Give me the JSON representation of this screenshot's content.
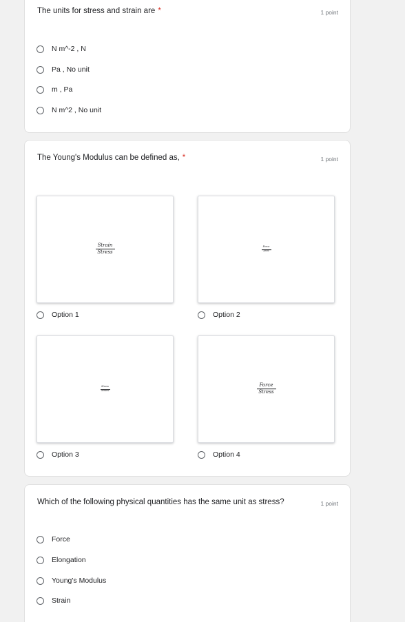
{
  "questions": [
    {
      "title": "The units for stress and strain are",
      "required_mark": "*",
      "points": "1 point",
      "options": [
        "N m^-2 , N",
        "Pa , No unit",
        "m , Pa",
        "N m^2 , No unit"
      ]
    },
    {
      "title": "The Young's Modulus can be defined as,",
      "required_mark": "*",
      "points": "1 point",
      "image_options": [
        {
          "label": "Option 1",
          "numerator": "Strain",
          "denominator": "Stress"
        },
        {
          "label": "Option 2",
          "numerator": "Force",
          "denominator": "Area"
        },
        {
          "label": "Option 3",
          "numerator": "Stress",
          "denominator": "Strain"
        },
        {
          "label": "Option 4",
          "numerator": "Force",
          "denominator": "Stress"
        }
      ]
    },
    {
      "title": "Which of the following physical quantities has the same unit as stress?",
      "points": "1 point",
      "options": [
        "Force",
        "Elongation",
        "Young's Modulus",
        "Strain"
      ]
    }
  ],
  "colors": {
    "background": "#f1f1f1",
    "card": "#ffffff",
    "required": "#d93025",
    "radio_border": "#5f6368"
  }
}
